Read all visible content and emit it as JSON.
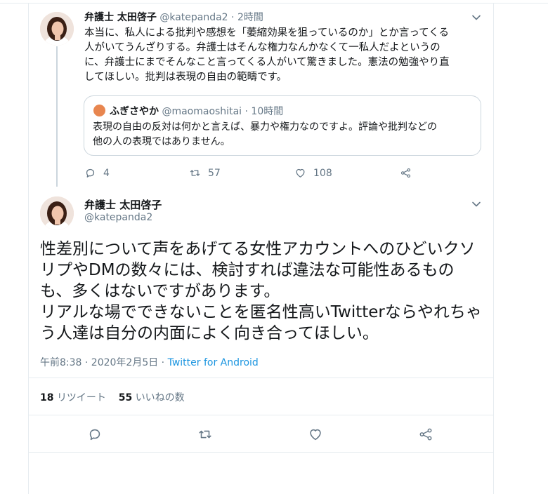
{
  "parent_tweet": {
    "display_name": "弁護士 太田啓子",
    "handle": "@katepanda2",
    "separator": "·",
    "time": "2時間",
    "text_lines": [
      "本当に、私人による批判や感想を「萎縮効果を狙っているのか」とか言ってくる",
      "人がいてうんざりする。弁護士はそんな権力なんかなくて一私人だよというの",
      "に、弁護士にまでそんなこと言ってくる人がいて驚きました。憲法の勉強やり直",
      "してほしい。批判は表現の自由の範疇です。"
    ],
    "quote": {
      "display_name": "ふぎさやか",
      "handle": "@maomaoshitai",
      "separator": "·",
      "time": "10時間",
      "text_lines": [
        "表現の自由の反対は何かと言えば、暴力や権力なのですよ。評論や批判などの",
        "他の人の表現ではありません。"
      ]
    },
    "actions": {
      "reply_count": "4",
      "retweet_count": "57",
      "like_count": "108"
    }
  },
  "main_tweet": {
    "display_name": "弁護士 太田啓子",
    "handle": "@katepanda2",
    "text_lines": [
      "性差別について声をあげてる女性アカウントへのひどいクソ",
      "リプやDMの数々には、検討すれば違法な可能性あるもの",
      "も、多くはないですがあります。",
      "リアルな場でできないことを匿名性高いTwitterならやれちゃ",
      "う人達は自分の内面によく向き合ってほしい。"
    ],
    "timestamp": "午前8:38 · 2020年2月5日",
    "meta_separator": " · ",
    "source": "Twitter for Android",
    "stats": {
      "retweets": "18",
      "retweets_label": "リツイート",
      "likes": "55",
      "likes_label": "いいねの数"
    }
  },
  "colors": {
    "text": "#14171a",
    "secondary": "#657786",
    "link": "#1b95e0",
    "border": "#e6ecf0"
  },
  "icons": [
    "reply-icon",
    "retweet-icon",
    "like-icon",
    "share-icon",
    "chevron-down-icon"
  ]
}
